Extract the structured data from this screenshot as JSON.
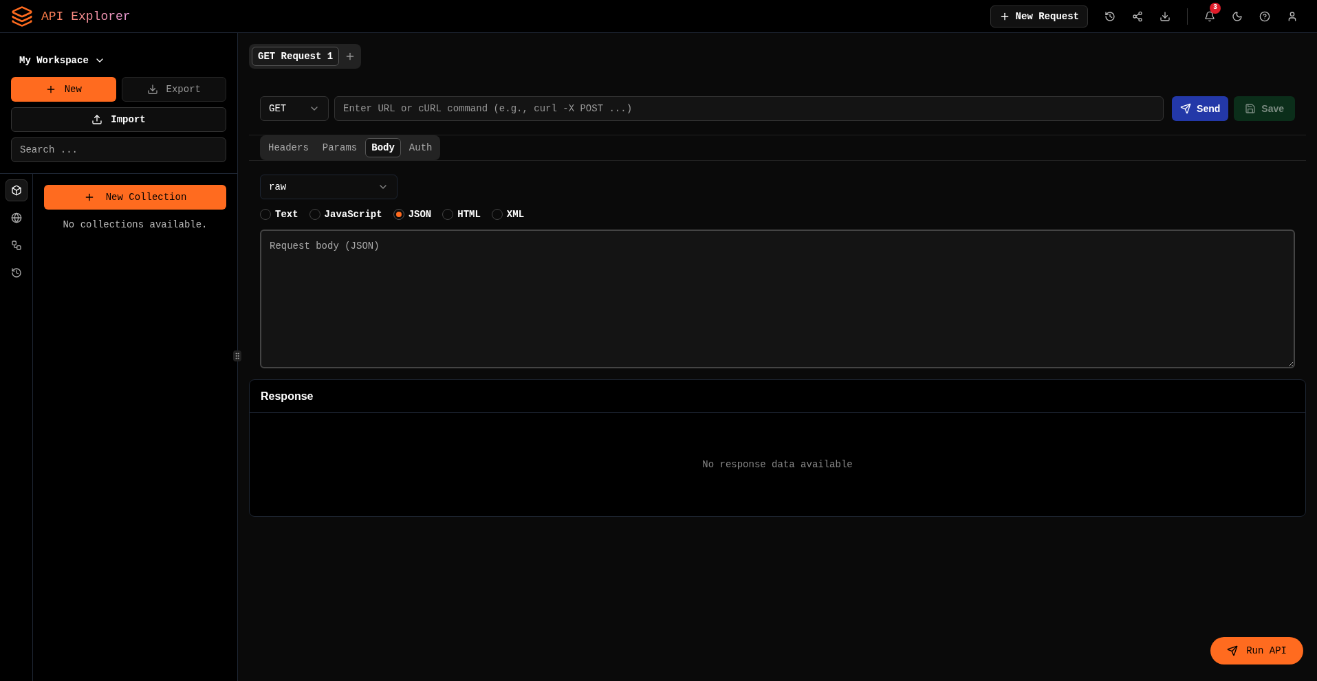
{
  "app": {
    "title": "API Explorer"
  },
  "topbar": {
    "new_request": "New Request",
    "notification_count": "3"
  },
  "sidebar": {
    "workspace": "My Workspace",
    "new": "New",
    "export": "Export",
    "import": "Import",
    "search_placeholder": "Search ...",
    "rail": [
      {
        "kind": "collections",
        "selected": true
      },
      {
        "kind": "environments",
        "selected": false
      },
      {
        "kind": "flows",
        "selected": false
      },
      {
        "kind": "history",
        "selected": false
      }
    ],
    "new_collection": "New Collection",
    "empty": "No collections available."
  },
  "request_tabs": [
    {
      "label": "GET Request 1",
      "selected": true
    }
  ],
  "request": {
    "method": "GET",
    "url_placeholder": "Enter URL or cURL command (e.g., curl -X POST ...)",
    "send": "Send",
    "save": "Save",
    "save_disabled": true
  },
  "section_tabs": [
    {
      "label": "Headers",
      "selected": false
    },
    {
      "label": "Params",
      "selected": false
    },
    {
      "label": "Body",
      "selected": true
    },
    {
      "label": "Auth",
      "selected": false
    }
  ],
  "body": {
    "type": "raw",
    "formats": [
      {
        "label": "Text",
        "selected": false
      },
      {
        "label": "JavaScript",
        "selected": false
      },
      {
        "label": "JSON",
        "selected": true
      },
      {
        "label": "HTML",
        "selected": false
      },
      {
        "label": "XML",
        "selected": false
      }
    ],
    "placeholder": "Request body (JSON)"
  },
  "response": {
    "title": "Response",
    "empty": "No response data available"
  },
  "run_button": "Run API"
}
